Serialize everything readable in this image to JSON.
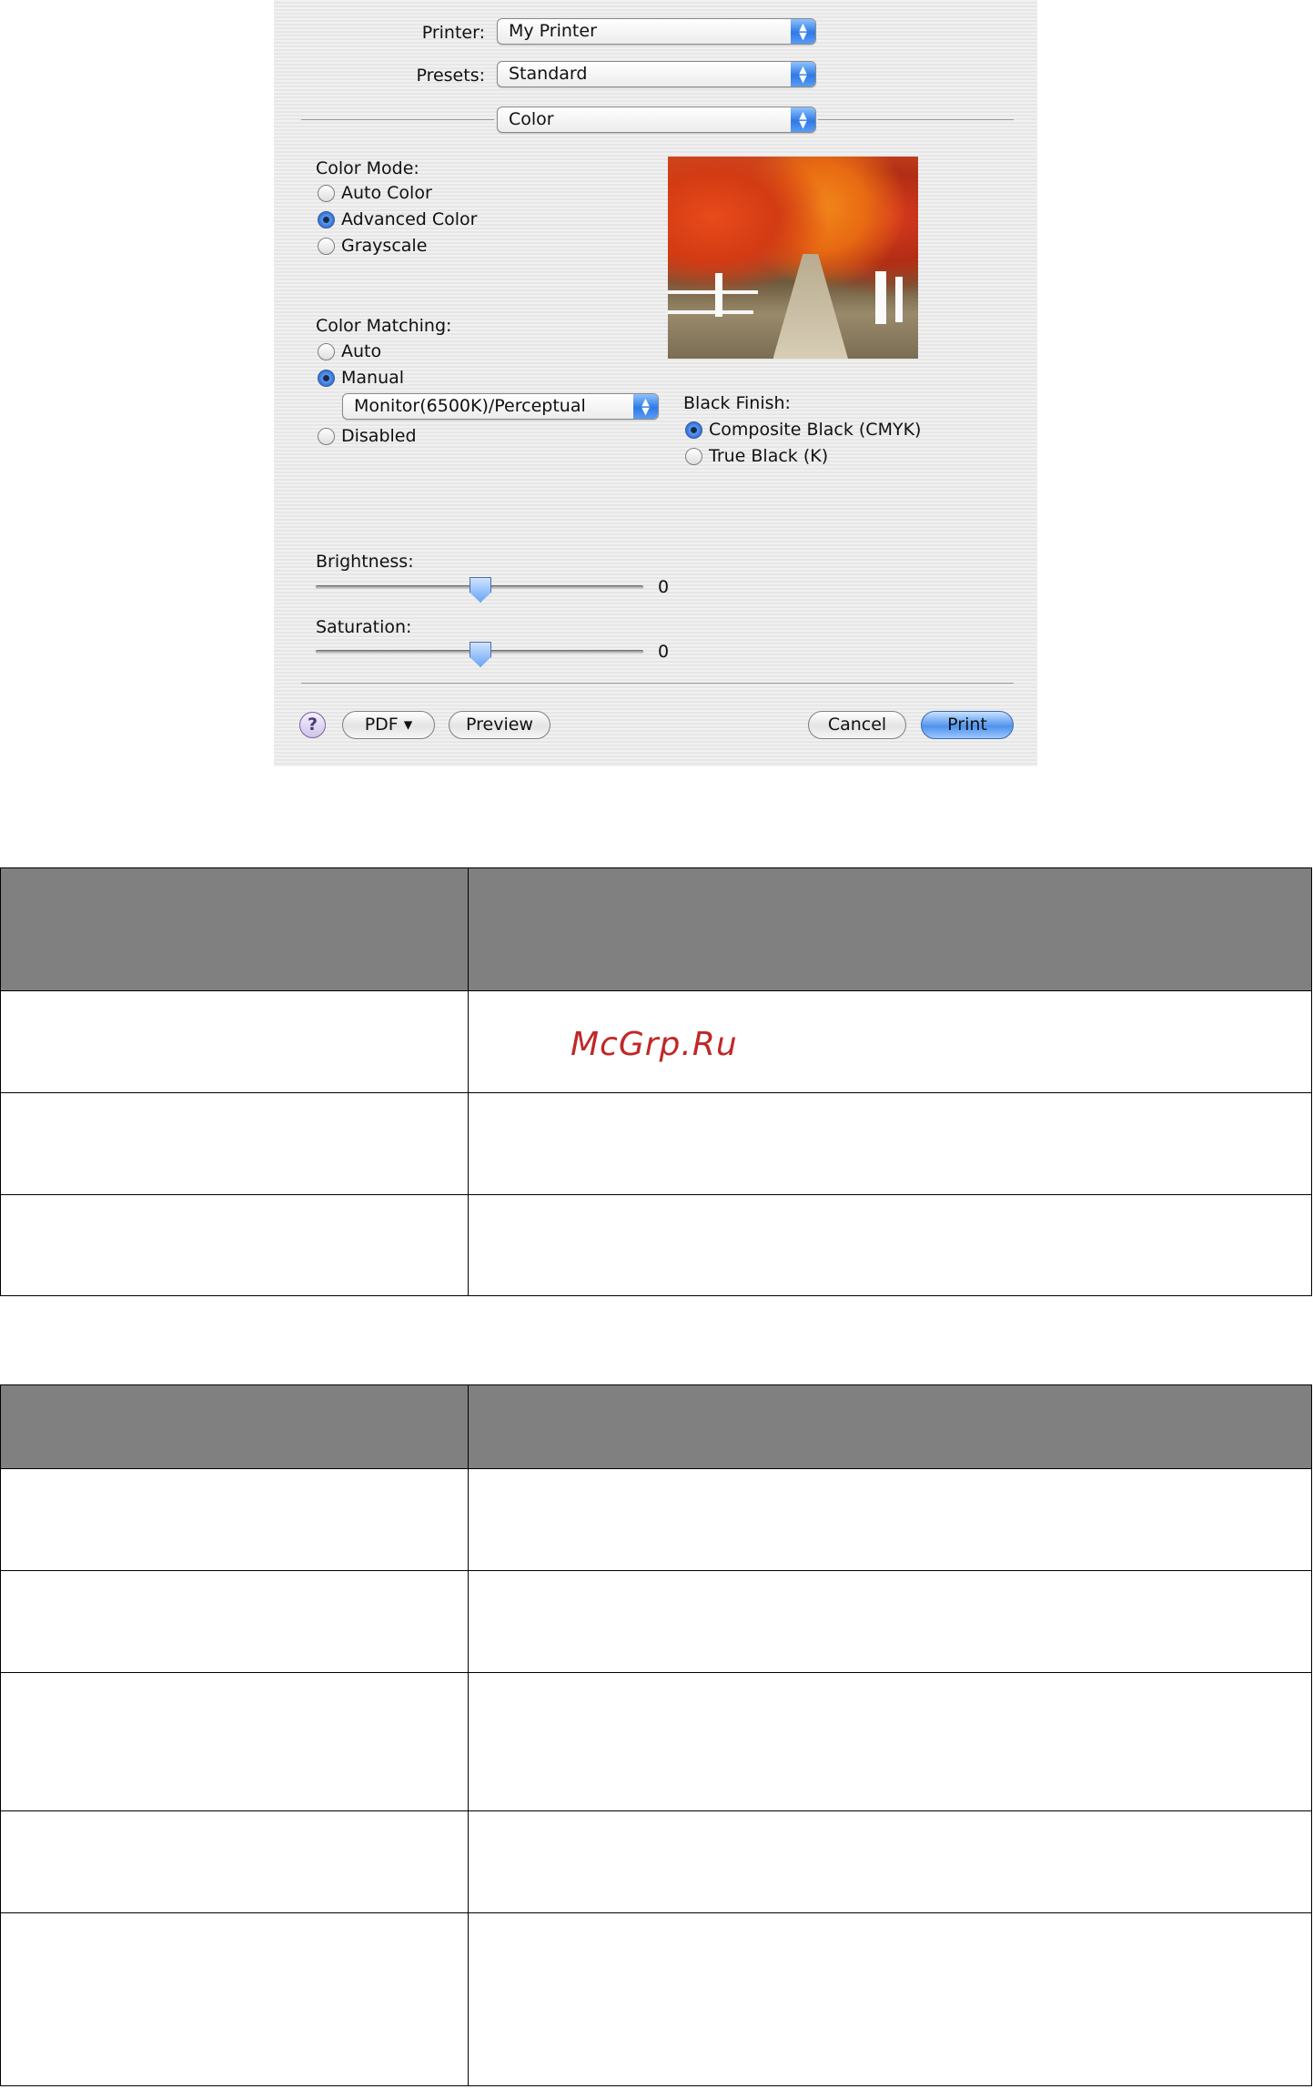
{
  "dialog": {
    "printer_label": "Printer:",
    "printer_value": "My Printer",
    "presets_label": "Presets:",
    "presets_value": "Standard",
    "panel_value": "Color",
    "color_mode": {
      "label": "Color Mode:",
      "options": [
        "Auto Color",
        "Advanced Color",
        "Grayscale"
      ],
      "selected": "Advanced Color"
    },
    "color_matching": {
      "label": "Color Matching:",
      "options": [
        "Auto",
        "Manual",
        "Disabled"
      ],
      "selected": "Manual",
      "profile_value": "Monitor(6500K)/Perceptual"
    },
    "black_finish": {
      "label": "Black Finish:",
      "options": [
        "Composite Black (CMYK)",
        "True Black (K)"
      ],
      "selected": "Composite Black (CMYK)"
    },
    "brightness": {
      "label": "Brightness:",
      "value": "0",
      "level_fraction": 0.5
    },
    "saturation": {
      "label": "Saturation:",
      "value": "0",
      "level_fraction": 0.5
    },
    "buttons": {
      "help": "?",
      "pdf": "PDF ▾",
      "preview": "Preview",
      "cancel": "Cancel",
      "print": "Print"
    }
  },
  "watermark": "McGrp.Ru",
  "colors": {
    "table_header": "#808080",
    "accent_blue": "#2f7ae6",
    "watermark": "#c02828"
  }
}
